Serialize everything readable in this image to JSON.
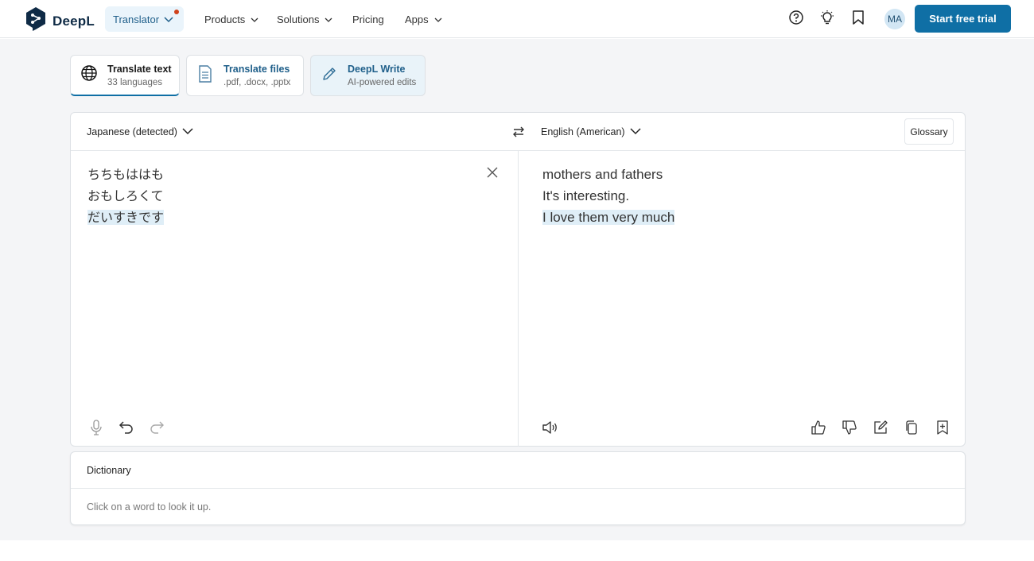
{
  "header": {
    "brand": "DeepL",
    "translator_label": "Translator",
    "nav": [
      {
        "label": "Products",
        "has_dropdown": true
      },
      {
        "label": "Solutions",
        "has_dropdown": true
      },
      {
        "label": "Pricing",
        "has_dropdown": false
      },
      {
        "label": "Apps",
        "has_dropdown": true
      }
    ],
    "icons": [
      "help-icon",
      "lightbulb-icon",
      "bookmark-icon"
    ],
    "avatar_initials": "MA",
    "cta_label": "Start free trial",
    "accent_color": "#0f6fa5",
    "notification_dot_color": "#d0421b"
  },
  "modes": [
    {
      "title": "Translate text",
      "subtitle": "33 languages",
      "icon": "globe-icon",
      "active": true
    },
    {
      "title": "Translate files",
      "subtitle": ".pdf, .docx, .pptx",
      "icon": "document-icon",
      "active": false
    },
    {
      "title": "DeepL Write",
      "subtitle": "AI-powered edits",
      "icon": "pencil-icon",
      "active": false
    }
  ],
  "translator": {
    "source_lang": "Japanese (detected)",
    "target_lang": "English (American)",
    "glossary_label": "Glossary",
    "source_lines": [
      "ちちもははも",
      "おもしろくて",
      "だいすきです"
    ],
    "target_lines": [
      "mothers and fathers",
      "It's interesting.",
      "I love them very much"
    ],
    "highlighted_line_index": 2
  },
  "dictionary": {
    "title": "Dictionary",
    "hint": "Click on a word to look it up."
  }
}
